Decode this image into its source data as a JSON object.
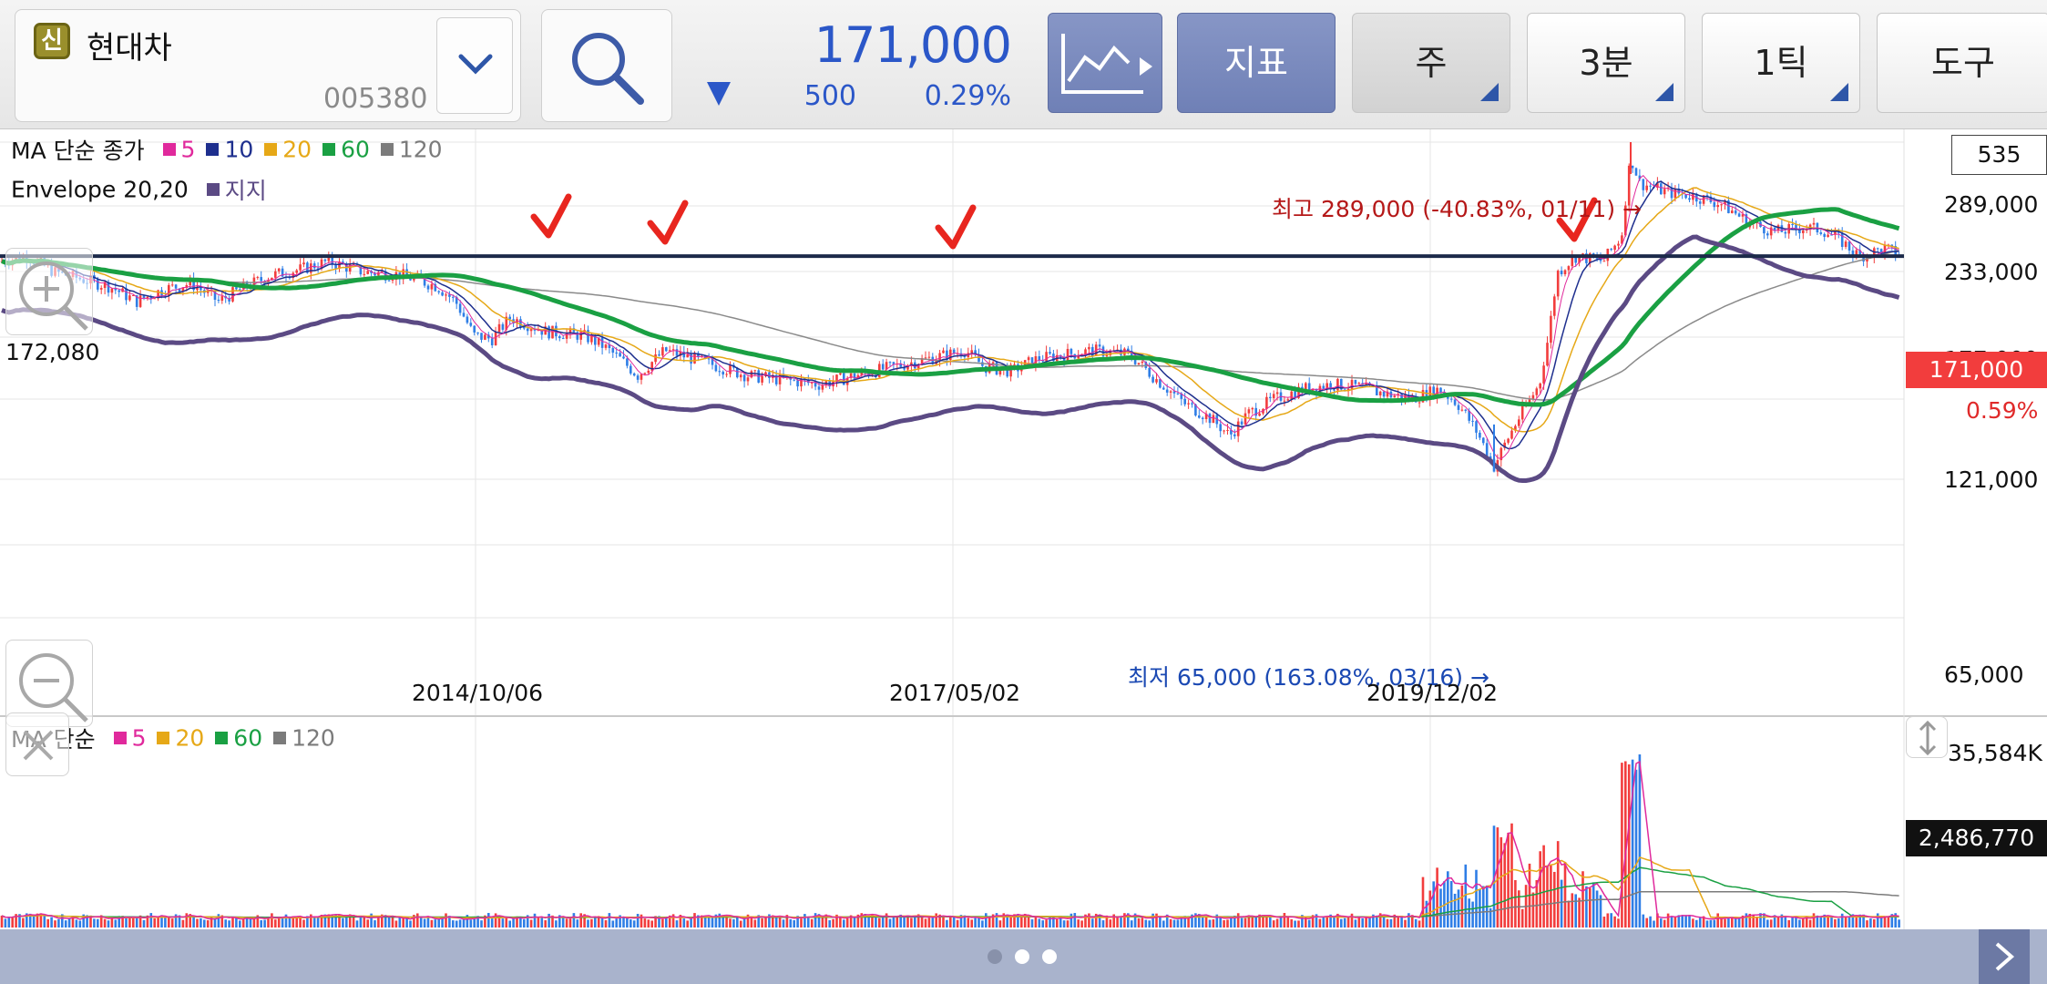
{
  "stock": {
    "badge": "신",
    "name": "현대차",
    "code": "005380",
    "price": "171,000",
    "change": "500",
    "change_pct": "0.29%"
  },
  "toolbar": {
    "indicator_label": "지표",
    "period_label": "주",
    "interval_label": "3분",
    "tick_label": "1틱",
    "tools_label": "도구"
  },
  "legend": {
    "ma_title": "MA 단순 종가",
    "ma_items": [
      {
        "label": "5",
        "color": "#e0299c"
      },
      {
        "label": "10",
        "color": "#1e2f8e"
      },
      {
        "label": "20",
        "color": "#e6a817"
      },
      {
        "label": "60",
        "color": "#1aa043"
      },
      {
        "label": "120",
        "color": "#7b7b7b"
      }
    ],
    "env_title": "Envelope 20,20",
    "env_item": {
      "label": "지지",
      "color": "#5b4a84"
    },
    "vol_title": "MA 단순",
    "vol_items": [
      {
        "label": "5",
        "color": "#e0299c"
      },
      {
        "label": "20",
        "color": "#e6a817"
      },
      {
        "label": "60",
        "color": "#1aa043"
      },
      {
        "label": "120",
        "color": "#7b7b7b"
      }
    ]
  },
  "annotations": {
    "bars_count": "535",
    "support_level_label": "172,080",
    "current_price_tag": "171,000",
    "current_pct": "0.59%",
    "high_note": "최고 289,000 (-40.83%, 01/11) →",
    "low_note": "최저 65,000 (163.08%, 03/16) →",
    "volume_tag": "2,486,770",
    "volume_max_label": "35,584K",
    "hidden_tick": "177,000"
  },
  "axes": {
    "y_ticks": [
      "289,000",
      "233,000",
      "121,000",
      "65,000"
    ],
    "x_ticks": [
      "2014/10/06",
      "2017/05/02",
      "2019/12/02"
    ]
  },
  "colors": {
    "up": "#f23d3d",
    "down": "#2f7ee6",
    "price_blue": "#2b57c8",
    "support_line": "#1c2a4a",
    "check_mark": "#e8261f"
  },
  "pager": {
    "pages": 3,
    "active": 1
  }
}
